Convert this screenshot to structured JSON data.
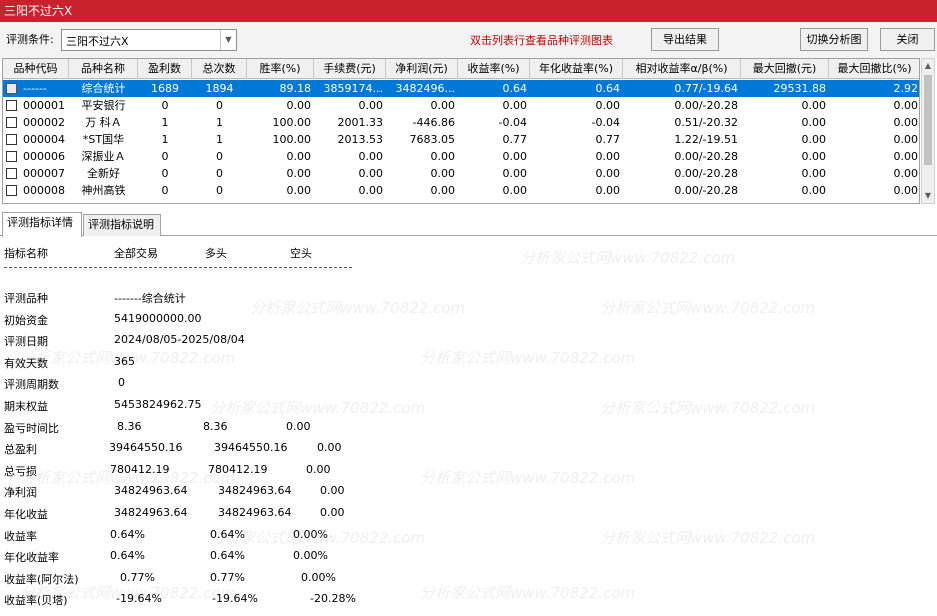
{
  "window": {
    "title": "三阳不过六X"
  },
  "toolbar": {
    "condition_label": "评测条件:",
    "condition_value": "三阳不过六X",
    "hint": "双击列表行查看品种评测图表",
    "export_label": "导出结果",
    "switch_label": "切换分析图",
    "close_label": "关闭"
  },
  "table": {
    "headers": [
      "品种代码",
      "品种名称",
      "盈利数",
      "总次数",
      "胜率(%)",
      "手续费(元)",
      "净利润(元)",
      "收益率(%)",
      "年化收益率(%)",
      "相对收益率α/β(%)",
      "最大回撤(元)",
      "最大回撤比(%)"
    ],
    "rows": [
      [
        "------",
        "综合统计",
        "1689",
        "1894",
        "89.18",
        "3859174...",
        "3482496...",
        "0.64",
        "0.64",
        "0.77/-19.64",
        "29531.88",
        "2.92"
      ],
      [
        "000001",
        "平安银行",
        "0",
        "0",
        "0.00",
        "0.00",
        "0.00",
        "0.00",
        "0.00",
        "0.00/-20.28",
        "0.00",
        "0.00"
      ],
      [
        "000002",
        "万 科Ａ",
        "1",
        "1",
        "100.00",
        "2001.33",
        "-446.86",
        "-0.04",
        "-0.04",
        "0.51/-20.32",
        "0.00",
        "0.00"
      ],
      [
        "000004",
        "*ST国华",
        "1",
        "1",
        "100.00",
        "2013.53",
        "7683.05",
        "0.77",
        "0.77",
        "1.22/-19.51",
        "0.00",
        "0.00"
      ],
      [
        "000006",
        "深振业Ａ",
        "0",
        "0",
        "0.00",
        "0.00",
        "0.00",
        "0.00",
        "0.00",
        "0.00/-20.28",
        "0.00",
        "0.00"
      ],
      [
        "000007",
        "全新好",
        "0",
        "0",
        "0.00",
        "0.00",
        "0.00",
        "0.00",
        "0.00",
        "0.00/-20.28",
        "0.00",
        "0.00"
      ],
      [
        "000008",
        "神州高铁",
        "0",
        "0",
        "0.00",
        "0.00",
        "0.00",
        "0.00",
        "0.00",
        "0.00/-20.28",
        "0.00",
        "0.00"
      ]
    ]
  },
  "tabs": {
    "detail": "评测指标详情",
    "desc": "评测指标说明"
  },
  "detail": {
    "header": [
      "指标名称",
      "全部交易",
      "多头",
      "空头"
    ],
    "rows": [
      [
        "评测品种",
        "-------综合统计"
      ],
      [
        "初始资金",
        "5419000000.00"
      ],
      [
        "评测日期",
        "2024/08/05-2025/08/04"
      ],
      [
        "有效天数",
        "365"
      ],
      [
        "评测周期数",
        "0"
      ],
      [
        "期末权益",
        "5453824962.75"
      ],
      [
        "盈亏时间比",
        "8.36",
        "8.36",
        "0.00"
      ],
      [
        "总盈利",
        "39464550.16",
        "39464550.16",
        "0.00"
      ],
      [
        "总亏损",
        "780412.19",
        "780412.19",
        "0.00"
      ],
      [
        "净利润",
        "34824963.64",
        "34824963.64",
        "0.00"
      ],
      [
        "年化收益",
        "34824963.64",
        "34824963.64",
        "0.00"
      ],
      [
        "收益率",
        "0.64%",
        "0.64%",
        "0.00%"
      ],
      [
        "年化收益率",
        "0.64%",
        "0.64%",
        "0.00%"
      ],
      [
        "收益率(阿尔法)",
        "0.77%",
        "0.77%",
        "0.00%"
      ],
      [
        "收益率(贝塔)",
        "-19.64%",
        "-19.64%",
        "-20.28%"
      ]
    ]
  },
  "watermark": "分析家公式网www.70822.com"
}
